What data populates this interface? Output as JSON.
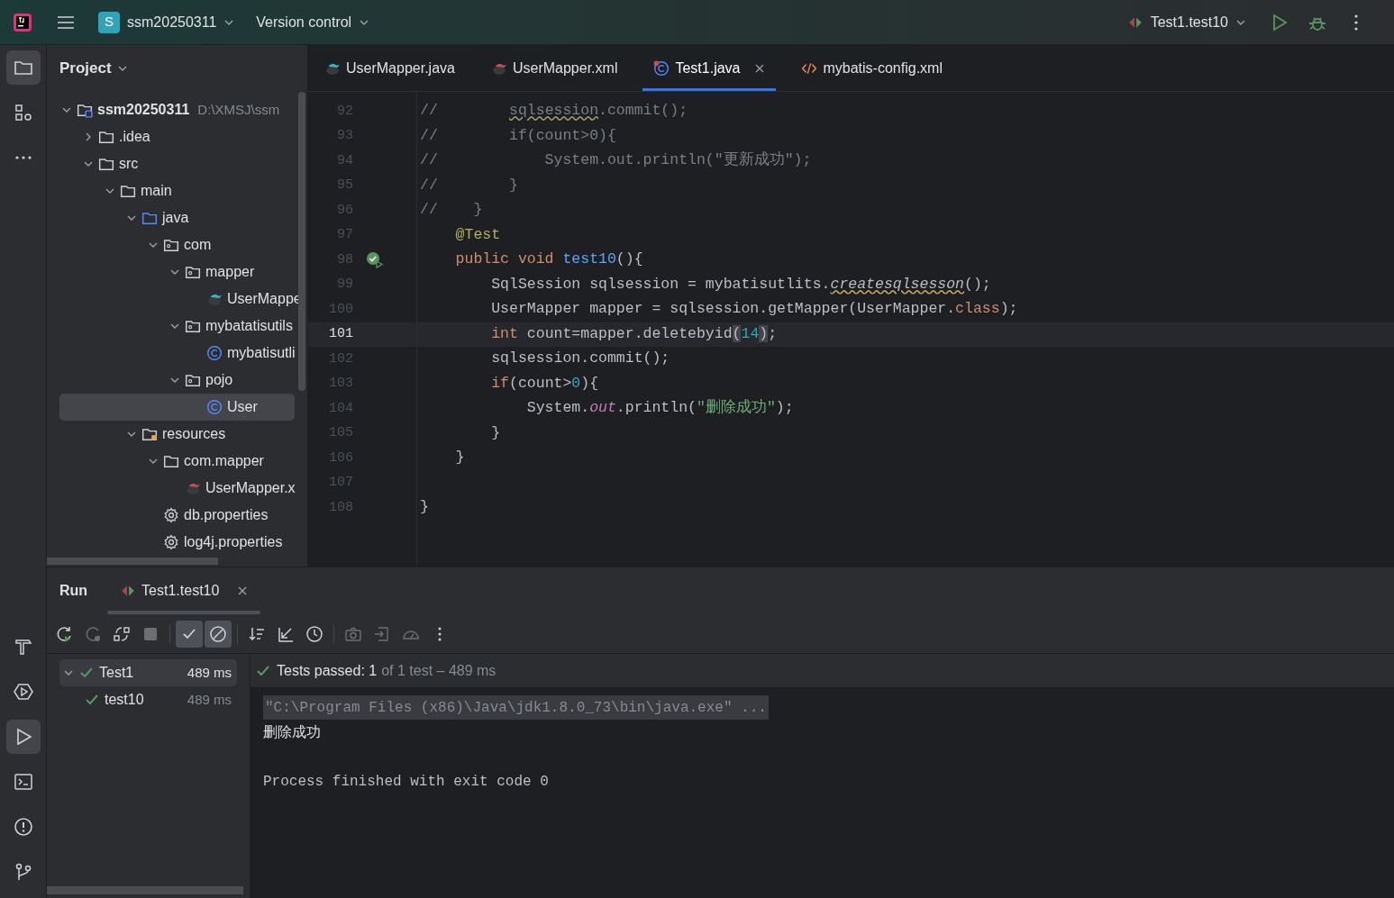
{
  "title_bar": {
    "project": {
      "badge": "S",
      "name": "ssm20250311"
    },
    "vcs": "Version control",
    "run_config": "Test1.test10"
  },
  "project_panel": {
    "title": "Project",
    "tree": [
      {
        "label": "ssm20250311",
        "hint": "D:\\XMSJ\\ssm",
        "kind": "module",
        "expanded": true,
        "selected": false,
        "children": [
          {
            "label": ".idea",
            "kind": "folder",
            "expanded": false,
            "selected": false
          },
          {
            "label": "src",
            "kind": "folder",
            "expanded": true,
            "selected": false,
            "children": [
              {
                "label": "main",
                "kind": "folder",
                "expanded": true,
                "selected": false,
                "children": [
                  {
                    "label": "java",
                    "kind": "source-folder",
                    "expanded": true,
                    "selected": false,
                    "children": [
                      {
                        "label": "com",
                        "kind": "package",
                        "expanded": true,
                        "selected": false,
                        "children": [
                          {
                            "label": "mapper",
                            "kind": "package",
                            "expanded": true,
                            "selected": false,
                            "children": [
                              {
                                "label": "UserMappe",
                                "kind": "mybatis-java",
                                "selected": false
                              }
                            ]
                          },
                          {
                            "label": "mybatatisutils",
                            "kind": "package",
                            "expanded": true,
                            "selected": false,
                            "children": [
                              {
                                "label": "mybatisutli",
                                "kind": "class",
                                "selected": false
                              }
                            ]
                          },
                          {
                            "label": "pojo",
                            "kind": "package",
                            "expanded": true,
                            "selected": false,
                            "children": [
                              {
                                "label": "User",
                                "kind": "class",
                                "selected": true
                              }
                            ]
                          }
                        ]
                      }
                    ]
                  },
                  {
                    "label": "resources",
                    "kind": "resources-folder",
                    "expanded": true,
                    "selected": false,
                    "children": [
                      {
                        "label": "com.mapper",
                        "kind": "folder",
                        "expanded": true,
                        "selected": false,
                        "children": [
                          {
                            "label": "UserMapper.x",
                            "kind": "mybatis-xml",
                            "selected": false
                          }
                        ]
                      },
                      {
                        "label": "db.properties",
                        "kind": "settings-file",
                        "selected": false
                      },
                      {
                        "label": "log4j.properties",
                        "kind": "settings-file",
                        "selected": false
                      }
                    ]
                  }
                ]
              }
            ]
          }
        ]
      }
    ]
  },
  "editor_tabs": [
    {
      "label": "UserMapper.java",
      "kind": "mybatis-java",
      "selected": false
    },
    {
      "label": "UserMapper.xml",
      "kind": "mybatis-xml",
      "selected": false
    },
    {
      "label": "Test1.java",
      "kind": "test-class",
      "selected": true,
      "closable": true
    },
    {
      "label": "mybatis-config.xml",
      "kind": "xml",
      "selected": false
    }
  ],
  "code_lines": [
    {
      "number": "92",
      "current": false,
      "tokens": [
        {
          "kind": "comment",
          "text": "//        "
        },
        {
          "kind": "warn",
          "text": "sqlsession"
        },
        {
          "kind": "comment",
          "text": ".commit();"
        }
      ]
    },
    {
      "number": "93",
      "current": false,
      "tokens": [
        {
          "kind": "comment",
          "text": "//        if(count>0){"
        }
      ]
    },
    {
      "number": "94",
      "current": false,
      "tokens": [
        {
          "kind": "comment",
          "text": "//            System.out.println(\"更新成功\");"
        }
      ]
    },
    {
      "number": "95",
      "current": false,
      "tokens": [
        {
          "kind": "comment",
          "text": "//        }"
        }
      ]
    },
    {
      "number": "96",
      "current": false,
      "tokens": [
        {
          "kind": "comment",
          "text": "//    }"
        }
      ]
    },
    {
      "number": "97",
      "current": false,
      "tokens": [
        {
          "kind": "annotation",
          "text": "    @Test"
        }
      ]
    },
    {
      "number": "98",
      "current": false,
      "test_passed": true,
      "tokens": [
        {
          "kind": "keyword",
          "text": "    public void "
        },
        {
          "kind": "method",
          "text": "test10"
        },
        {
          "kind": "plain",
          "text": "(){"
        }
      ]
    },
    {
      "number": "99",
      "current": false,
      "tokens": [
        {
          "kind": "plain",
          "text": "        SqlSession sqlsession = mybatisutlits."
        },
        {
          "kind": "static-warn",
          "text": "createsqlsesson"
        },
        {
          "kind": "plain",
          "text": "();"
        }
      ]
    },
    {
      "number": "100",
      "current": false,
      "tokens": [
        {
          "kind": "plain",
          "text": "        UserMapper mapper = sqlsession.getMapper(UserMapper."
        },
        {
          "kind": "keyword",
          "text": "class"
        },
        {
          "kind": "plain",
          "text": ");"
        }
      ]
    },
    {
      "number": "101",
      "current": true,
      "tokens": [
        {
          "kind": "keyword",
          "text": "        int "
        },
        {
          "kind": "plain",
          "text": "count=mapper.deletebyid"
        },
        {
          "kind": "brace",
          "text": "("
        },
        {
          "kind": "number",
          "text": "14"
        },
        {
          "kind": "brace",
          "text": ")"
        },
        {
          "kind": "plain",
          "text": ";"
        }
      ]
    },
    {
      "number": "102",
      "current": false,
      "tokens": [
        {
          "kind": "plain",
          "text": "        sqlsession.commit();"
        }
      ]
    },
    {
      "number": "103",
      "current": false,
      "tokens": [
        {
          "kind": "keyword",
          "text": "        if"
        },
        {
          "kind": "plain",
          "text": "(count>"
        },
        {
          "kind": "number",
          "text": "0"
        },
        {
          "kind": "plain",
          "text": "){"
        }
      ]
    },
    {
      "number": "104",
      "current": false,
      "tokens": [
        {
          "kind": "plain",
          "text": "            System."
        },
        {
          "kind": "static-field",
          "text": "out"
        },
        {
          "kind": "plain",
          "text": ".println("
        },
        {
          "kind": "string",
          "text": "\"删除成功\""
        },
        {
          "kind": "plain",
          "text": ");"
        }
      ]
    },
    {
      "number": "105",
      "current": false,
      "tokens": [
        {
          "kind": "plain",
          "text": "        }"
        }
      ]
    },
    {
      "number": "106",
      "current": false,
      "tokens": [
        {
          "kind": "plain",
          "text": "    }"
        }
      ]
    },
    {
      "number": "107",
      "current": false
    },
    {
      "number": "108",
      "current": false,
      "tokens": [
        {
          "kind": "plain",
          "text": "}"
        }
      ]
    }
  ],
  "run_panel": {
    "title": "Run",
    "tab": {
      "label": "Test1.test10",
      "selected": true
    },
    "toolbar": [
      {
        "kind": "rerun",
        "disabled": false,
        "selected": false
      },
      {
        "kind": "rerun-failed",
        "disabled": true,
        "selected": false
      },
      {
        "kind": "toggle-auto",
        "disabled": false,
        "selected": false
      },
      {
        "kind": "stop",
        "disabled": true,
        "selected": false
      },
      {
        "kind": "show-passed",
        "disabled": false,
        "selected": true
      },
      {
        "kind": "show-ignored",
        "disabled": false,
        "selected": true
      },
      {
        "kind": "sort",
        "disabled": false,
        "selected": false
      },
      {
        "kind": "collapse",
        "disabled": false,
        "selected": false
      },
      {
        "kind": "history",
        "disabled": false,
        "selected": false
      },
      {
        "kind": "camera",
        "disabled": true,
        "selected": false
      },
      {
        "kind": "export",
        "disabled": true,
        "selected": false
      },
      {
        "kind": "gauge",
        "disabled": true,
        "selected": false
      },
      {
        "kind": "more",
        "disabled": false,
        "selected": false
      }
    ],
    "tests": [
      {
        "label": "Test1",
        "time": "489 ms",
        "expanded": true,
        "selected": true,
        "children": [
          {
            "label": "test10",
            "time": "489 ms",
            "selected": false
          }
        ]
      }
    ],
    "summary": {
      "strong": "Tests passed: 1",
      "rest": "of 1 test – 489 ms"
    },
    "console": [
      {
        "kind": "command",
        "text": "\"C:\\Program Files (x86)\\Java\\jdk1.8.0_73\\bin\\java.exe\" ..."
      },
      {
        "kind": "output",
        "text": "删除成功"
      },
      {
        "kind": "exit",
        "text": "Process finished with exit code 0"
      }
    ]
  }
}
